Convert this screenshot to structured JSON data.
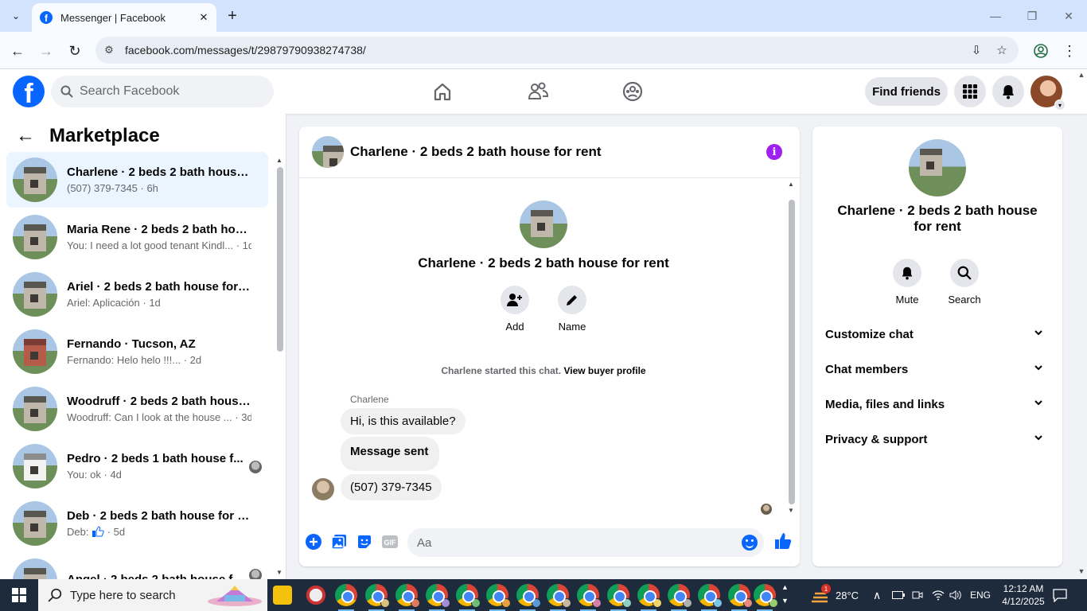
{
  "browser": {
    "tab_title": "Messenger | Facebook",
    "url": "facebook.com/messages/t/29879790938274738/"
  },
  "fb": {
    "search_placeholder": "Search Facebook",
    "find_friends": "Find friends"
  },
  "sidebar": {
    "title": "Marketplace",
    "conversations": [
      {
        "name": "Charlene · 2 beds 2 bath house f...",
        "snippet": "(507) 379-7345 · 6h",
        "active": true
      },
      {
        "name": "Maria Rene · 2 beds 2 bath hous...",
        "snippet": "You: I need a lot good tenant Kindl... · 1d"
      },
      {
        "name": "Ariel · 2 beds 2 bath house for r...",
        "snippet": "Ariel: Aplicación · 1d"
      },
      {
        "name": "Fernando · Tucson, AZ",
        "snippet": "Fernando: Helo helo !!!... · 2d"
      },
      {
        "name": "Woodruff · 2 beds 2 bath house ...",
        "snippet": "Woodruff: Can I look at the house ... · 3d"
      },
      {
        "name": "Pedro · 2 beds 1 bath house f...",
        "snippet": "You: ok · 4d"
      },
      {
        "name": "Deb · 2 beds 2 bath house for rent",
        "snippet_prefix": "Deb:",
        "snippet_suffix": "· 5d"
      },
      {
        "name": "Angel · 2 beds 2 bath house f...",
        "snippet": ""
      }
    ]
  },
  "chat": {
    "title": "Charlene · 2 beds 2 bath house for rent",
    "intro_title": "Charlene · 2 beds 2 bath house for rent",
    "actions": {
      "add": "Add",
      "name": "Name"
    },
    "started_text": "Charlene started this chat.",
    "view_profile": "View buyer profile",
    "sender": "Charlene",
    "messages": [
      "Hi, is this available?",
      "Message sent",
      "(507) 379-7345"
    ],
    "composer_placeholder": "Aa"
  },
  "details": {
    "title": "Charlene · 2 beds 2 bath house for rent",
    "mute": "Mute",
    "search": "Search",
    "sections": [
      "Customize chat",
      "Chat members",
      "Media, files and links",
      "Privacy & support"
    ]
  },
  "taskbar": {
    "search_placeholder": "Type here to search",
    "temperature": "28°C",
    "language": "ENG",
    "time": "12:12 AM",
    "date": "4/12/2025",
    "weather_badge": "1"
  },
  "colors": {
    "fb_blue": "#0866ff",
    "accent_purple": "#a020f0",
    "active_row": "#ebf5ff"
  }
}
